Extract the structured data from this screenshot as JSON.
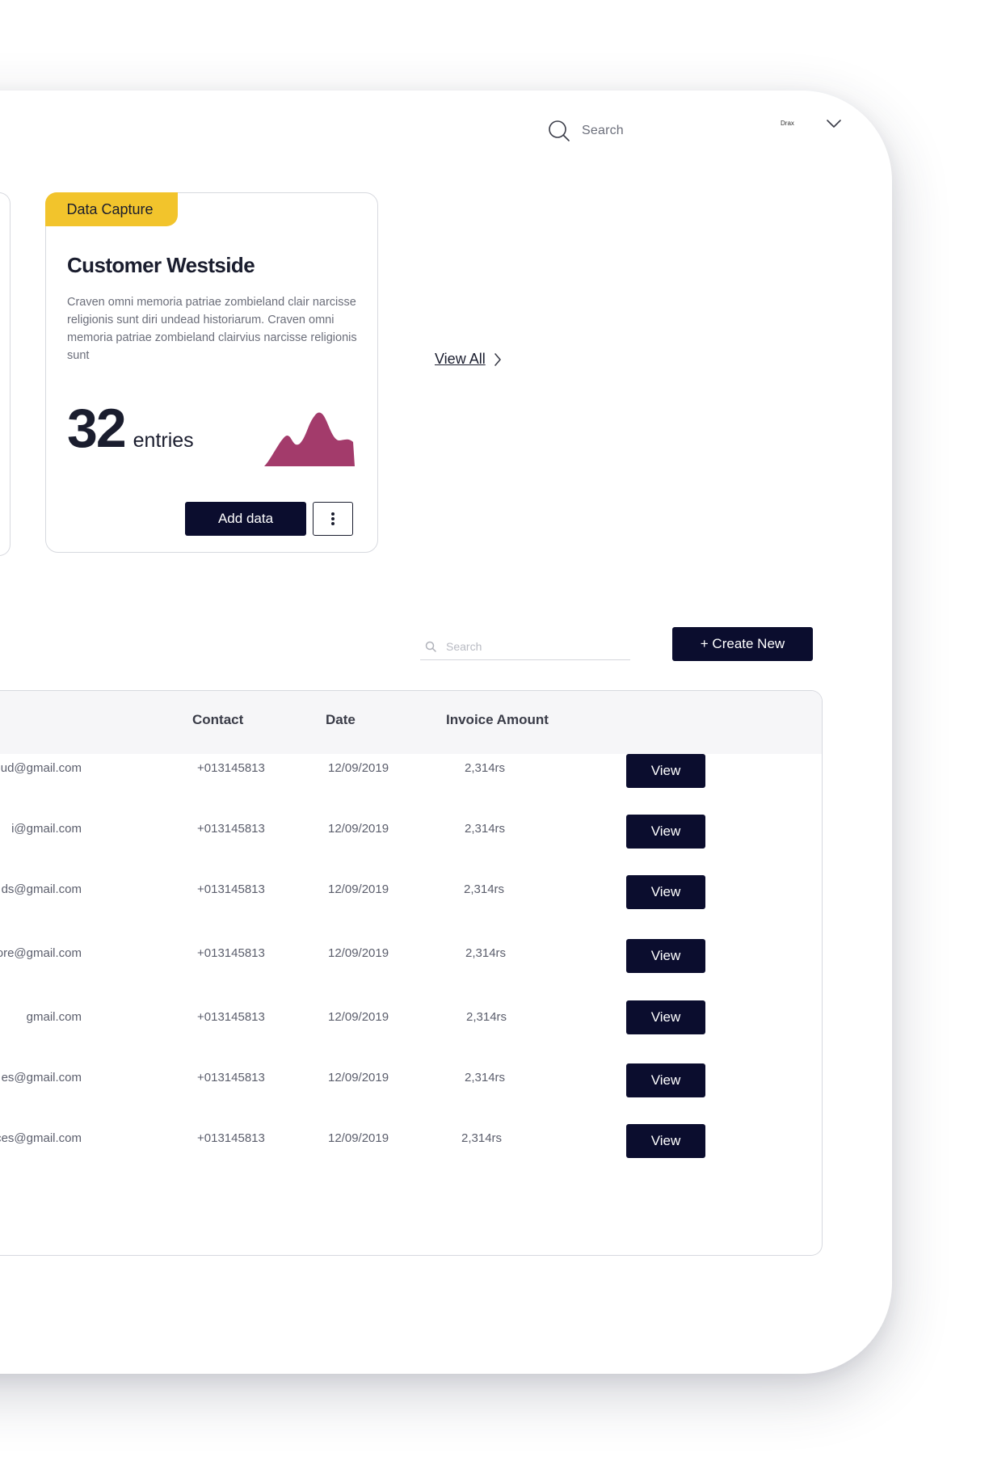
{
  "header": {
    "search_label": "Search",
    "user_name": "Drax"
  },
  "card": {
    "tag": "Data Capture",
    "title": "Customer Westside",
    "description": "Craven omni memoria patriae zombieland clair narcisse religionis sunt diri undead historiarum. Craven omni memoria patriae zombieland clairvius narcisse religionis sunt",
    "count": "32",
    "count_unit": "entries",
    "add_label": "Add data",
    "chart_color": "#a33b6b"
  },
  "view_all_label": "View All",
  "toolbar": {
    "search_placeholder": "Search",
    "create_label": "+ Create New"
  },
  "table": {
    "columns": [
      "Contact",
      "Date",
      "Invoice Amount"
    ],
    "rows": [
      {
        "email": "roud@gmail.com",
        "contact": "+013145813",
        "date": "12/09/2019",
        "amount": "2,314rs",
        "action": "View"
      },
      {
        "email": "i@gmail.com",
        "contact": "+013145813",
        "date": "12/09/2019",
        "amount": "2,314rs",
        "action": "View"
      },
      {
        "email": "ds@gmail.com",
        "contact": "+013145813",
        "date": "12/09/2019",
        "amount": "2,314rs",
        "action": "View"
      },
      {
        "email": "oore@gmail.com",
        "contact": "+013145813",
        "date": "12/09/2019",
        "amount": "2,314rs",
        "action": "View"
      },
      {
        "email": "gmail.com",
        "contact": "+013145813",
        "date": "12/09/2019",
        "amount": "2,314rs",
        "action": "View"
      },
      {
        "email": "es@gmail.com",
        "contact": "+013145813",
        "date": "12/09/2019",
        "amount": "2,314rs",
        "action": "View"
      },
      {
        "email": "rces@gmail.com",
        "contact": "+013145813",
        "date": "12/09/2019",
        "amount": "2,314rs",
        "action": "View"
      }
    ]
  },
  "colors": {
    "accent_yellow": "#f2c42c",
    "button_navy": "#0b0d2e",
    "chart_magenta": "#a33b6b"
  }
}
